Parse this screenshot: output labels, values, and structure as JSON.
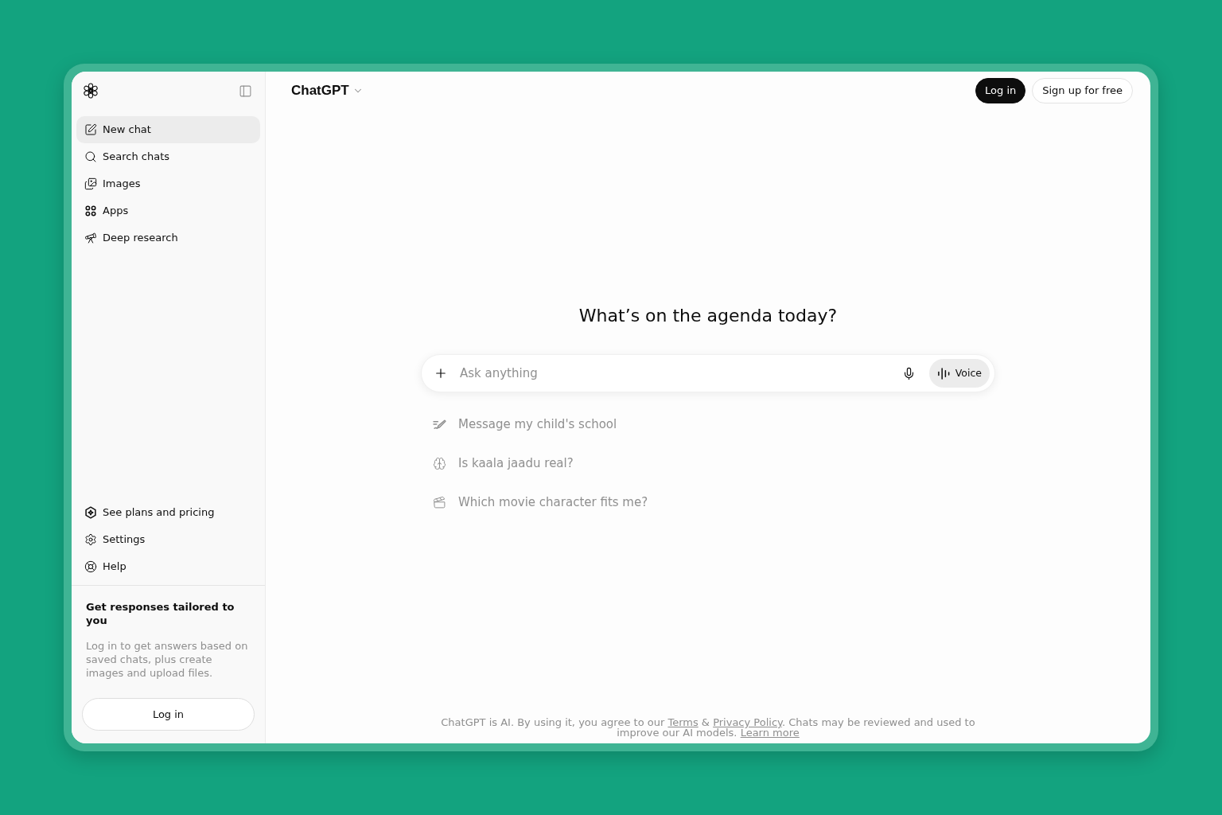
{
  "sidebar": {
    "top_items": [
      {
        "label": "New chat",
        "selected": true
      },
      {
        "label": "Search chats",
        "selected": false
      },
      {
        "label": "Images",
        "selected": false
      },
      {
        "label": "Apps",
        "selected": false
      },
      {
        "label": "Deep research",
        "selected": false
      }
    ],
    "bottom_items": [
      {
        "label": "See plans and pricing",
        "selected": false
      },
      {
        "label": "Settings",
        "selected": false
      },
      {
        "label": "Help",
        "selected": false
      }
    ],
    "promo": {
      "title": "Get responses tailored to you",
      "text": "Log in to get answers based on saved chats, plus create images and upload files.",
      "button": "Log in"
    }
  },
  "header": {
    "title": "ChatGPT",
    "buttons": [
      {
        "label": "Log in",
        "kind": "primary"
      },
      {
        "label": "Sign up for free",
        "kind": "secondary"
      }
    ]
  },
  "heading": "What’s on the agenda today?",
  "composer": {
    "placeholder": "Ask anything",
    "voice_button": "Voice"
  },
  "suggestions": [
    {
      "label": "Message my child's school"
    },
    {
      "label": "Is kaala jaadu real?"
    },
    {
      "label": "Which movie character fits me?"
    }
  ],
  "footer": {
    "parts": [
      {
        "kind": "text",
        "text": "ChatGPT is AI. By using it, you agree to our "
      },
      {
        "kind": "link",
        "text": "Terms"
      },
      {
        "kind": "text",
        "text": " & "
      },
      {
        "kind": "link",
        "text": "Privacy Policy"
      },
      {
        "kind": "text",
        "text": ". Chats may be reviewed and used to improve our AI models. "
      },
      {
        "kind": "link",
        "text": "Learn more"
      }
    ]
  }
}
